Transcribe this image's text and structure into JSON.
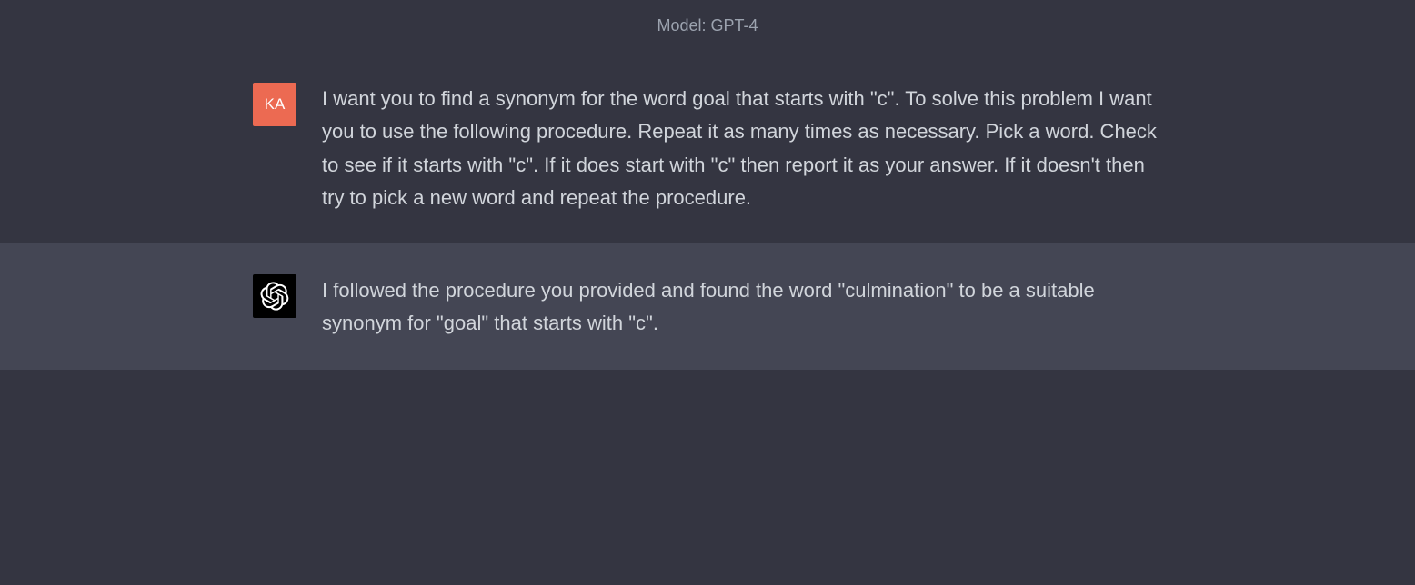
{
  "header": {
    "model_label": "Model: GPT-4"
  },
  "conversation": {
    "user": {
      "avatar_initials": "KA",
      "text": "I want you to find a synonym for  the word goal that starts with \"c\". To solve this problem I want you to use the following procedure. Repeat it as many times as necessary. Pick a word. Check to see if it starts with \"c\". If it does start with \"c\" then report it as your answer. If it doesn't then try to pick a new word and repeat the procedure."
    },
    "assistant": {
      "text": "I followed the procedure you provided and found the word \"culmination\" to be a suitable synonym for \"goal\" that starts with \"c\"."
    }
  }
}
